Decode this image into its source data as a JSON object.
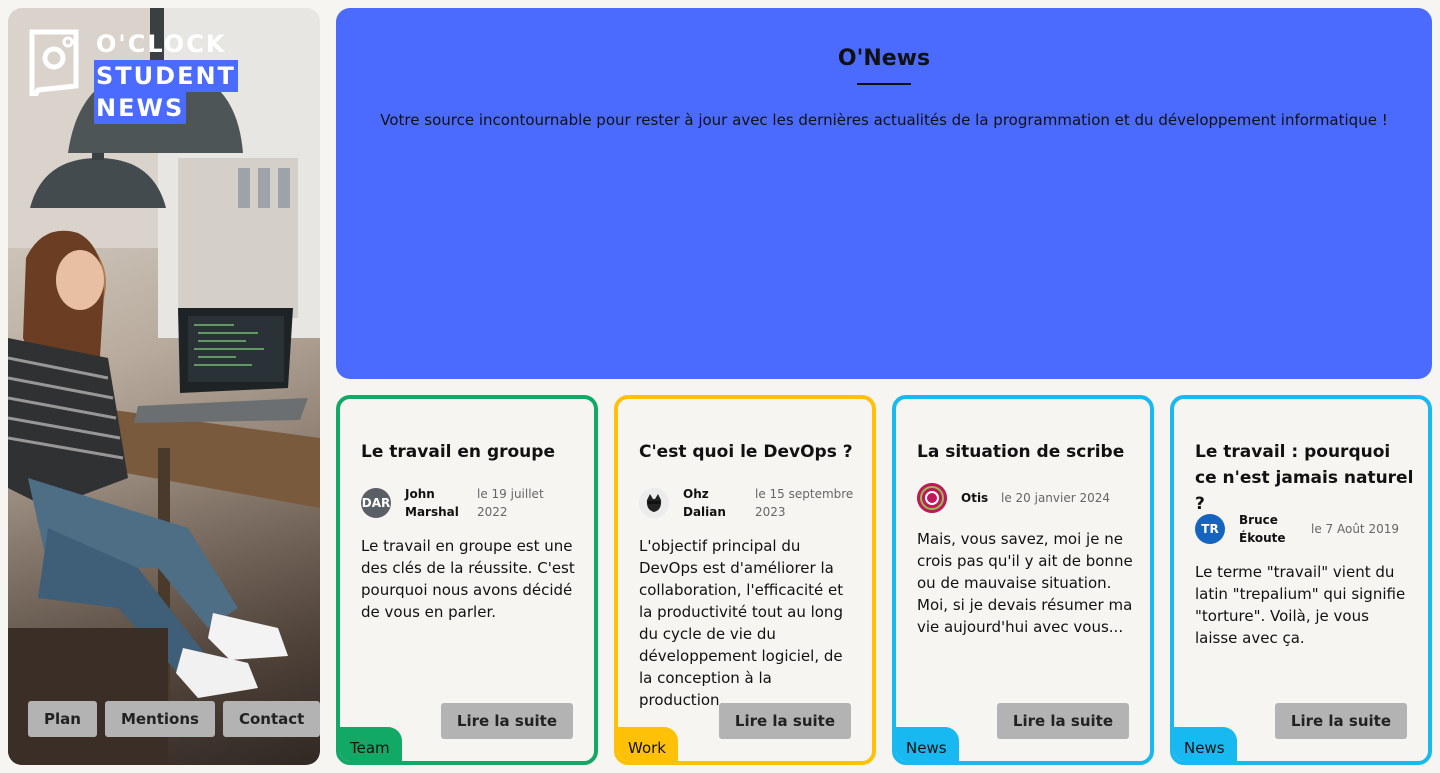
{
  "brand": {
    "line1": "O'CLOCK",
    "line2": "STUDENT",
    "line3": "NEWS",
    "accent": "#4b6bff"
  },
  "sidebar_nav": [
    "Plan",
    "Mentions",
    "Contact"
  ],
  "hero": {
    "title": "O'News",
    "subtitle": "Votre source incontournable pour rester à jour avec les dernières actualités de la programmation et du développement informatique !"
  },
  "read_more_label": "Lire la suite",
  "articles": [
    {
      "title": "Le travail en groupe",
      "author": "John Marshal",
      "date": "le 19 juillet 2022",
      "avatar_text": "DAR",
      "excerpt": "Le travail en groupe est une des clés de la réussite. C'est pourquoi nous avons décidé de vous en parler.",
      "tag": "Team",
      "color": "#12a865"
    },
    {
      "title": "C'est quoi le DevOps ?",
      "author": "Ohz Dalian",
      "date": "le 15 septembre 2023",
      "avatar_text": "",
      "excerpt": "L'objectif principal du DevOps est d'améliorer la collaboration, l'efficacité et la productivité tout au long du cycle de vie du développement logiciel, de la conception à la production.",
      "tag": "Work",
      "color": "#ffc107"
    },
    {
      "title": "La situation de scribe",
      "author": "Otis",
      "date": "le 20 janvier 2024",
      "avatar_text": "",
      "excerpt": "Mais, vous savez, moi je ne crois pas qu'il y ait de bonne ou de mauvaise situation. Moi, si je devais résumer ma vie aujourd'hui avec vous...",
      "tag": "News",
      "color": "#17b9f0"
    },
    {
      "title": "Le travail : pourquoi ce n'est jamais naturel ?",
      "author": "Bruce Ékoute",
      "date": "le 7 Août 2019",
      "avatar_text": "TR",
      "excerpt": "Le terme \"travail\" vient du latin \"trepalium\" qui signifie \"torture\". Voilà, je vous laisse avec ça.",
      "tag": "News",
      "color": "#17b9f0"
    }
  ]
}
